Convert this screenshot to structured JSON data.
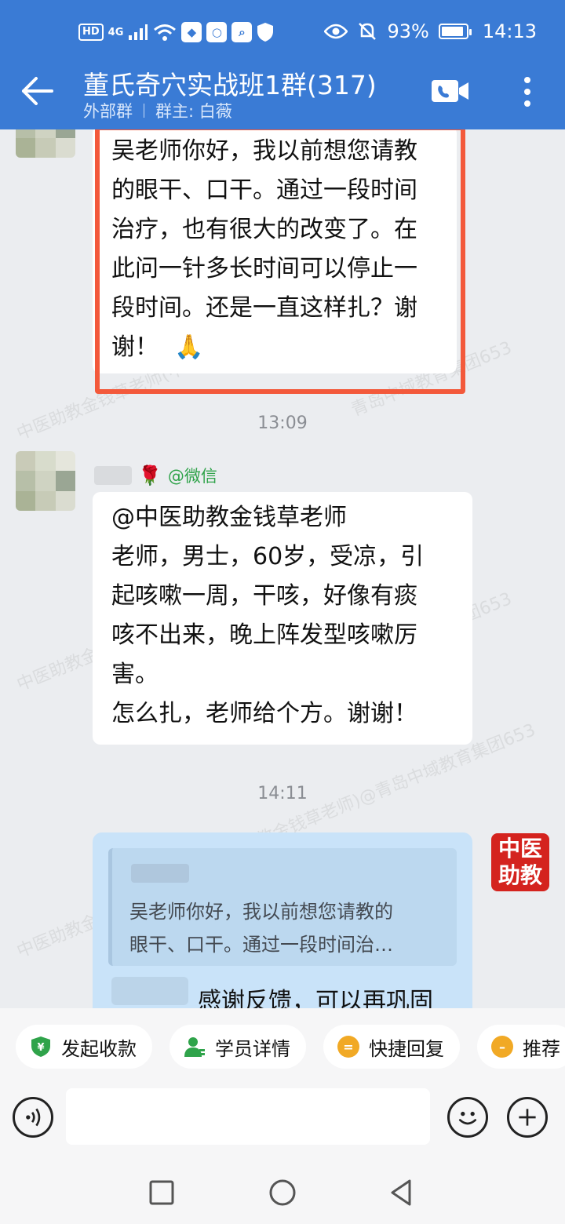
{
  "status_bar": {
    "left_chips": [
      "HD",
      "4G"
    ],
    "battery_percent": "93%",
    "battery_level": 0.93,
    "time": "14:13"
  },
  "header": {
    "title": "董氏奇穴实战班1群(317)",
    "group_type": "外部群",
    "owner": "群主: 白薇",
    "background_color": "#3a7bd5"
  },
  "messages": {
    "m1": {
      "lines": [
        "吴老师你好，我以前想您请教",
        "的眼干、口干。通过一段时间",
        "治疗，也有很大的改变了。在",
        "此问一针多长时间可以停止一",
        "段时间。还是一直这样扎？谢",
        "谢！"
      ],
      "emoji": "🙏",
      "highlight_color": "#f3593b"
    },
    "time1": "13:09",
    "m2": {
      "source": "@微信",
      "lines": [
        "@中医助教金钱草老师",
        "老师，男士，60岁，受凉，引",
        "起咳嗽一周，干咳，好像有痰",
        "咳不出来，晚上阵发型咳嗽厉",
        "害。",
        "怎么扎，老师给个方。谢谢！"
      ]
    },
    "time2": "14:11",
    "m3": {
      "quote_lines": [
        "吴老师你好，我以前想您请教的",
        "眼干、口干。通过一段时间治…"
      ],
      "reply_text": "感谢反馈，可以再巩固",
      "avatar_text": [
        "中医",
        "助教"
      ]
    }
  },
  "watermark": {
    "line_a": "中医助教金钱草老师(中医助",
    "line_b": "青岛中域教育集团653",
    "line_c": "中医助教金钱草老师)@青岛中域教育集团653"
  },
  "quick_actions": [
    "发起收款",
    "学员详情",
    "快捷回复",
    "推荐"
  ],
  "input": {
    "placeholder": ""
  }
}
